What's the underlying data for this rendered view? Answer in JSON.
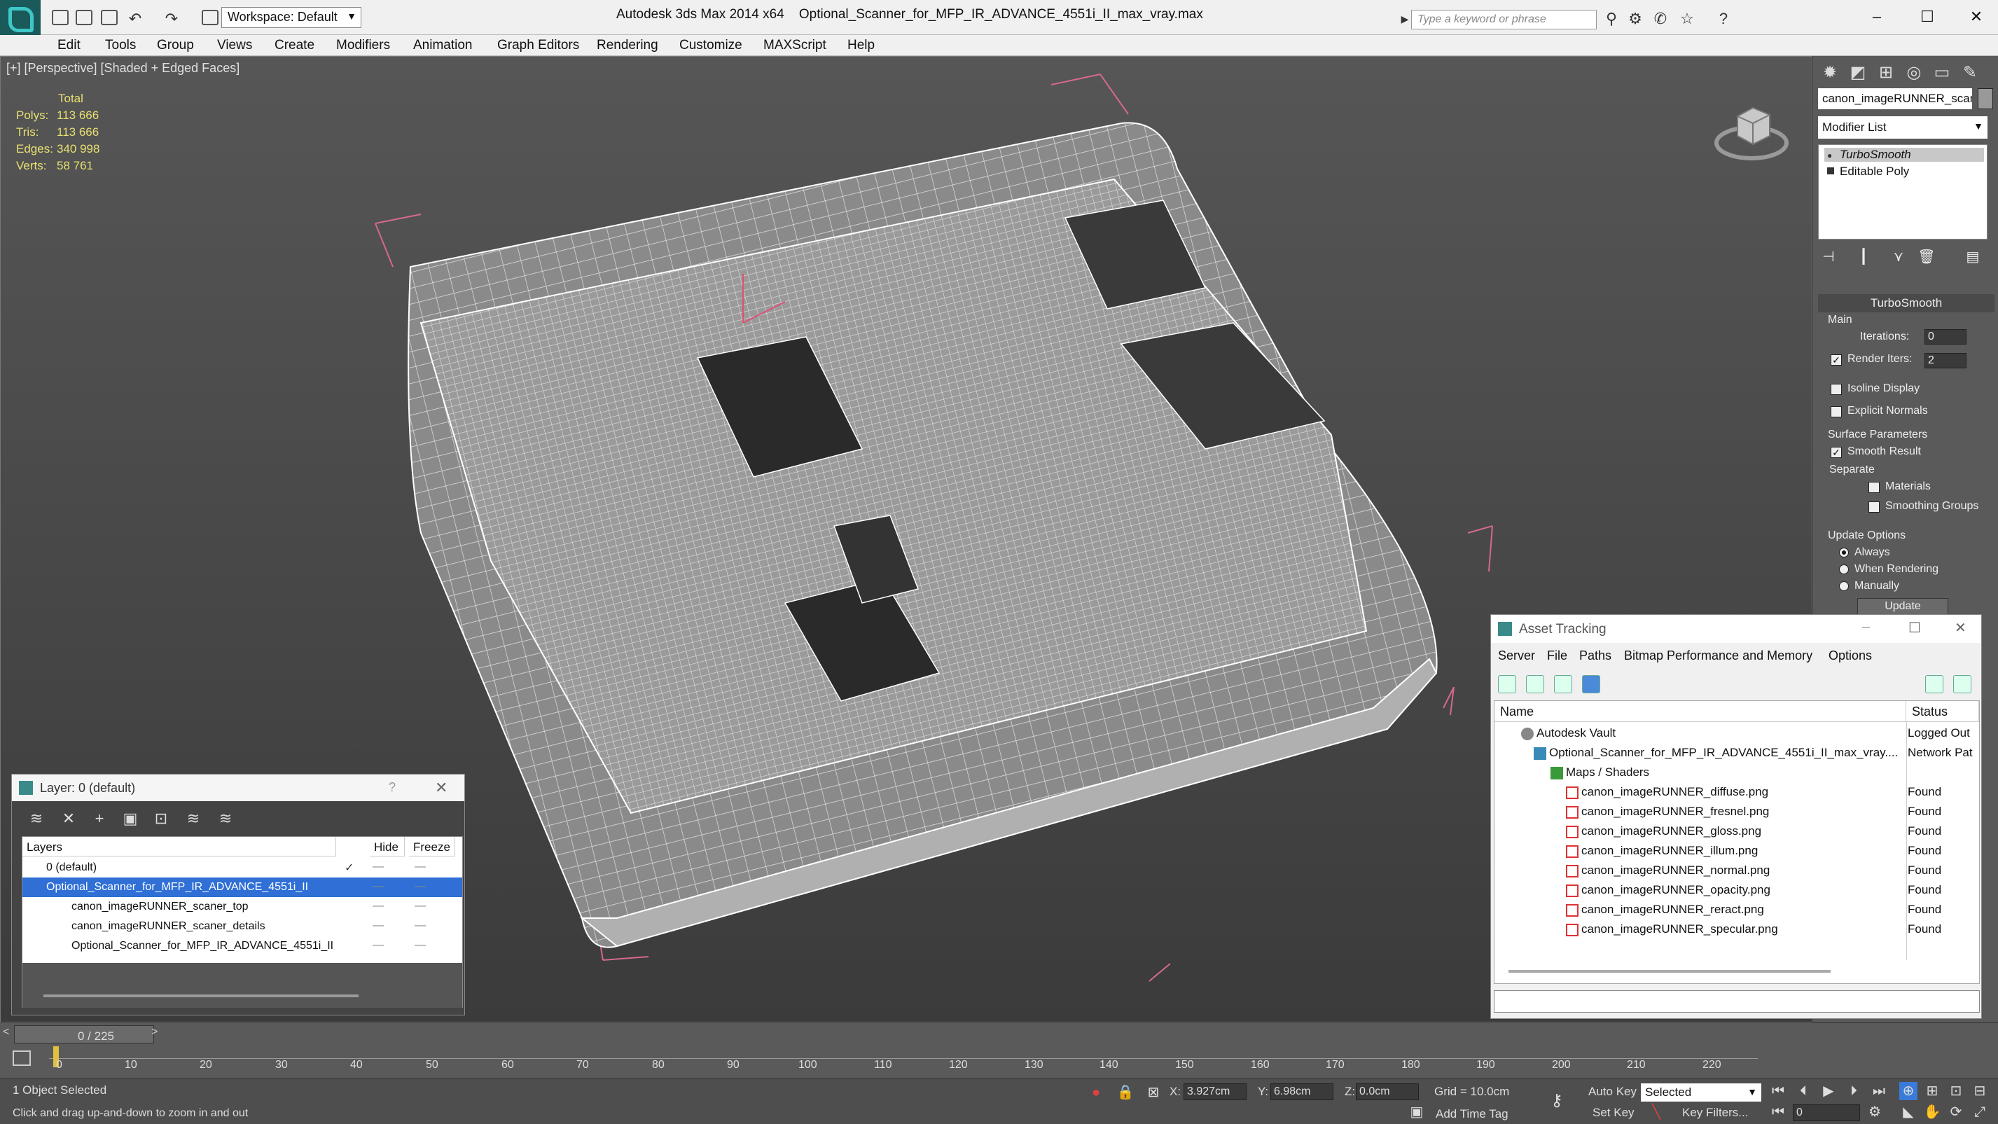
{
  "titlebar": {
    "workspace": "Workspace: Default",
    "app": "Autodesk 3ds Max  2014 x64",
    "file": "Optional_Scanner_for_MFP_IR_ADVANCE_4551i_II_max_vray.max",
    "search_placeholder": "Type a keyword or phrase"
  },
  "menu": [
    "Edit",
    "Tools",
    "Group",
    "Views",
    "Create",
    "Modifiers",
    "Animation",
    "Graph Editors",
    "Rendering",
    "Customize",
    "MAXScript",
    "Help"
  ],
  "viewport": {
    "label": "[+] [Perspective] [Shaded + Edged Faces]",
    "stats": {
      "header": "Total",
      "rows": [
        {
          "label": "Polys:",
          "value": "113 666"
        },
        {
          "label": "Tris:",
          "value": "113 666"
        },
        {
          "label": "Edges:",
          "value": "340 998"
        },
        {
          "label": "Verts:",
          "value": "58 761"
        }
      ]
    }
  },
  "command_panel": {
    "object_name": "canon_imageRUNNER_scaner",
    "modifier_list": "Modifier List",
    "stack": [
      "TurboSmooth",
      "Editable Poly"
    ],
    "rollout": {
      "title": "TurboSmooth",
      "main": "Main",
      "iterations_label": "Iterations:",
      "iterations": "0",
      "render_iters_label": "Render Iters:",
      "render_iters": "2",
      "isoline": "Isoline Display",
      "explicit": "Explicit Normals",
      "surface": "Surface Parameters",
      "smooth_result": "Smooth Result",
      "separate": "Separate",
      "materials": "Materials",
      "smoothing_groups": "Smoothing Groups",
      "update_options": "Update Options",
      "always": "Always",
      "when_rendering": "When Rendering",
      "manually": "Manually",
      "update": "Update"
    }
  },
  "layer_window": {
    "title": "Layer: 0 (default)",
    "help": "?",
    "columns": [
      "Layers",
      "Hide",
      "Freeze"
    ],
    "rows": [
      {
        "name": "0 (default)"
      },
      {
        "name": "Optional_Scanner_for_MFP_IR_ADVANCE_4551i_II"
      },
      {
        "name": "canon_imageRUNNER_scaner_top"
      },
      {
        "name": "canon_imageRUNNER_scaner_details"
      },
      {
        "name": "Optional_Scanner_for_MFP_IR_ADVANCE_4551i_II"
      }
    ]
  },
  "asset_tracking": {
    "title": "Asset Tracking",
    "menu": [
      "Server",
      "File",
      "Paths",
      "Bitmap Performance and Memory",
      "Options"
    ],
    "columns": [
      "Name",
      "Status"
    ],
    "rows": [
      {
        "name": "Autodesk Vault",
        "status": "Logged Out"
      },
      {
        "name": "Optional_Scanner_for_MFP_IR_ADVANCE_4551i_II_max_vray....",
        "status": "Network Pat"
      },
      {
        "name": "Maps / Shaders",
        "status": ""
      },
      {
        "name": "canon_imageRUNNER_diffuse.png",
        "status": "Found"
      },
      {
        "name": "canon_imageRUNNER_fresnel.png",
        "status": "Found"
      },
      {
        "name": "canon_imageRUNNER_gloss.png",
        "status": "Found"
      },
      {
        "name": "canon_imageRUNNER_illum.png",
        "status": "Found"
      },
      {
        "name": "canon_imageRUNNER_normal.png",
        "status": "Found"
      },
      {
        "name": "canon_imageRUNNER_opacity.png",
        "status": "Found"
      },
      {
        "name": "canon_imageRUNNER_reract.png",
        "status": "Found"
      },
      {
        "name": "canon_imageRUNNER_specular.png",
        "status": "Found"
      }
    ]
  },
  "timeline": {
    "frame": "0 / 225",
    "ticks": [
      "0",
      "10",
      "20",
      "30",
      "40",
      "50",
      "60",
      "70",
      "80",
      "90",
      "100",
      "110",
      "120",
      "130",
      "140",
      "150",
      "160",
      "170",
      "180",
      "190",
      "200",
      "210",
      "220"
    ]
  },
  "status": {
    "selected": "1 Object Selected",
    "hint": "Click and drag up-and-down to zoom in and out",
    "x_label": "X:",
    "x": "3.927cm",
    "y_label": "Y:",
    "y": "6.98cm",
    "z_label": "Z:",
    "z": "0.0cm",
    "grid": "Grid = 10.0cm",
    "add_time_tag": "Add Time Tag",
    "auto_key": "Auto Key",
    "set_key": "Set Key",
    "selected_dd": "Selected",
    "key_filters": "Key Filters...",
    "frame_field": "0"
  }
}
